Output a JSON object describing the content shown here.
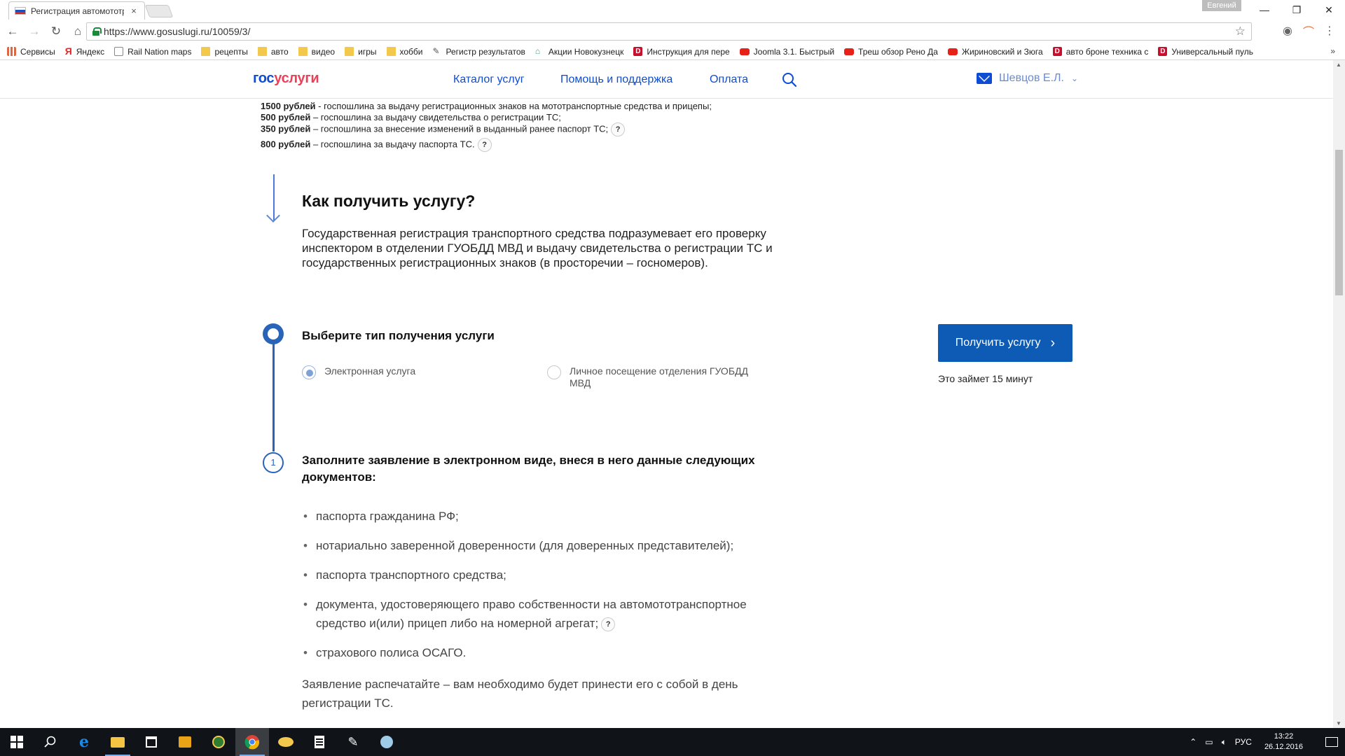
{
  "browser": {
    "tab_title": "Регистрация автомототранспортных средств",
    "tab_close": "×",
    "profile": "Евгений",
    "url": "https://www.gosuslugi.ru/10059/3/",
    "window_minimize": "—",
    "window_restore": "❐",
    "window_close": "✕"
  },
  "bookmarks": [
    {
      "icon": "grid",
      "label": "Сервисы"
    },
    {
      "icon": "ya",
      "label": "Яндекс"
    },
    {
      "icon": "page",
      "label": "Rail Nation maps"
    },
    {
      "icon": "folder",
      "label": "рецепты"
    },
    {
      "icon": "folder",
      "label": "авто"
    },
    {
      "icon": "folder",
      "label": "видео"
    },
    {
      "icon": "folder",
      "label": "игры"
    },
    {
      "icon": "folder",
      "label": "хобби"
    },
    {
      "icon": "pen",
      "label": "Регистр результатов"
    },
    {
      "icon": "house",
      "label": "Акции Новокузнецк"
    },
    {
      "icon": "d",
      "label": "Инструкция для пере"
    },
    {
      "icon": "yt",
      "label": "Joomla 3.1. Быстрый"
    },
    {
      "icon": "yt",
      "label": "Треш обзор Рено Да"
    },
    {
      "icon": "yt",
      "label": "Жириновский и Зюга"
    },
    {
      "icon": "d",
      "label": "авто броне техника с"
    },
    {
      "icon": "d",
      "label": "Универсальный пуль"
    }
  ],
  "bookmarks_more": "»",
  "header": {
    "logo_gos": "гос",
    "logo_uslugi": "услуги",
    "nav": [
      "Каталог услуг",
      "Помощь и поддержка",
      "Оплата"
    ],
    "user_name": "Шевцов Е.Л.",
    "user_chevron": "⌄"
  },
  "fees": [
    {
      "amount": "1500 рублей",
      "text": " - госпошлина за выдачу регистрационных знаков на мототранспортные средства и прицепы;",
      "help": false
    },
    {
      "amount": "500 рублей",
      "text": " – госпошлина за выдачу свидетельства о регистрации ТС;",
      "help": false
    },
    {
      "amount": "350 рублей",
      "text": " – госпошлина за внесение изменений в выданный ранее паспорт ТС;",
      "help": true
    },
    {
      "amount": "800 рублей",
      "text": " – госпошлина за выдачу паспорта ТС.",
      "help": true
    }
  ],
  "help_badge": "?",
  "how": {
    "title": "Как получить услугу?",
    "lead": "Государственная регистрация транспортного средства подразумевает его проверку инспектором в отделении ГУОБДД МВД и выдачу свидетельства о регистрации ТС и государственных регистрационных знаков (в просторечии – госномеров)."
  },
  "step_choose": {
    "title": "Выберите тип получения услуги",
    "options": [
      {
        "label": "Электронная услуга",
        "checked": true
      },
      {
        "label": "Личное посещение отделения ГУОБДД МВД",
        "checked": false
      }
    ]
  },
  "cta": {
    "label": "Получить услугу",
    "chevron": "›",
    "note": "Это займет 15 минут"
  },
  "step_fill": {
    "number": "1",
    "title": "Заполните заявление в электронном виде, внеся в него данные следующих документов:",
    "documents": [
      "паспорта гражданина РФ;",
      "нотариально заверенной доверенности (для доверенных представителей);",
      "паспорта транспортного средства;",
      "документа, удостоверяющего право собственности на автомототранспортное средство и(или) прицеп либо на номерной агрегат;",
      "страхового полиса ОСАГО."
    ],
    "after": "Заявление распечатайте – вам необходимо будет принести его с собой в день регистрации ТС."
  },
  "taskbar": {
    "apps": [
      "start",
      "search",
      "edge",
      "explorer",
      "store",
      "media",
      "globe",
      "chrome",
      "batman",
      "calculator",
      "pen",
      "tools"
    ],
    "tray": {
      "language": "РУС",
      "time": "13:22",
      "date": "26.12.2016"
    }
  }
}
